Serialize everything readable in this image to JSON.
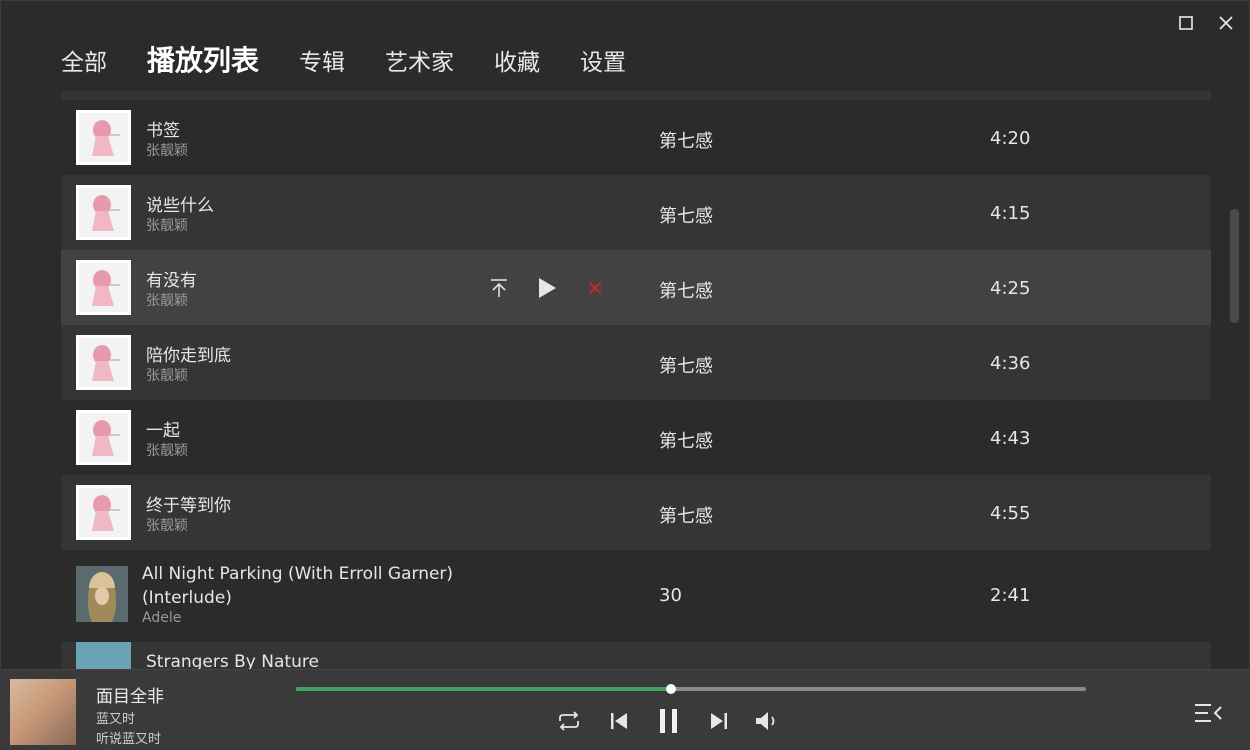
{
  "window": {
    "maximize_icon": "maximize-icon",
    "close_icon": "close-icon"
  },
  "nav": {
    "items": [
      {
        "label": "全部",
        "active": false
      },
      {
        "label": "播放列表",
        "active": true
      },
      {
        "label": "专辑",
        "active": false
      },
      {
        "label": "艺术家",
        "active": false
      },
      {
        "label": "收藏",
        "active": false
      },
      {
        "label": "设置",
        "active": false
      }
    ]
  },
  "songs": [
    {
      "title": "书签",
      "artist": "张靓颖",
      "album": "第七感",
      "duration": "4:20"
    },
    {
      "title": "说些什么",
      "artist": "张靓颖",
      "album": "第七感",
      "duration": "4:15"
    },
    {
      "title": "有没有",
      "artist": "张靓颖",
      "album": "第七感",
      "duration": "4:25"
    },
    {
      "title": "陪你走到底",
      "artist": "张靓颖",
      "album": "第七感",
      "duration": "4:36"
    },
    {
      "title": "一起",
      "artist": "张靓颖",
      "album": "第七感",
      "duration": "4:43"
    },
    {
      "title": "终于等到你",
      "artist": "张靓颖",
      "album": "第七感",
      "duration": "4:55"
    },
    {
      "title": "All Night Parking (With Erroll Garner) (Interlude)",
      "artist": "Adele",
      "album": "30",
      "duration": "2:41"
    },
    {
      "title": "Strangers By Nature",
      "artist": "",
      "album": "",
      "duration": ""
    }
  ],
  "row_actions": {
    "move_top_icon": "move-to-top-icon",
    "play_icon": "play-icon",
    "remove_icon": "remove-icon",
    "remove_color": "#c0282d"
  },
  "player": {
    "title": "面目全非",
    "artist": "蓝又时",
    "album": "听说蓝又时",
    "progress": 0.475,
    "accent_color": "#3fa45f",
    "icons": [
      "repeat-icon",
      "previous-icon",
      "pause-icon",
      "next-icon",
      "volume-icon",
      "queue-icon"
    ]
  }
}
